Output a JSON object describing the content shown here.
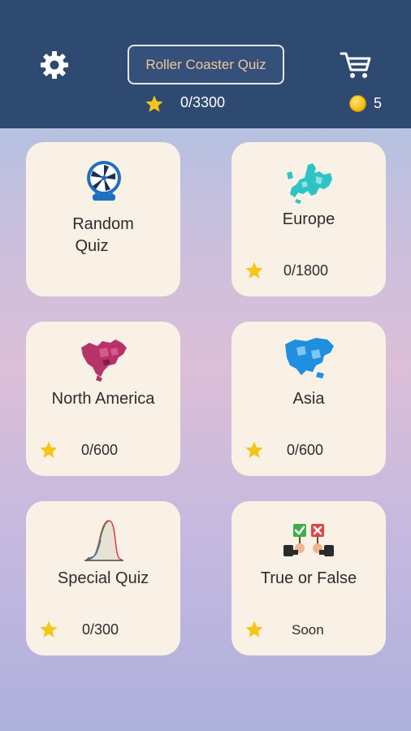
{
  "header": {
    "title": "Roller Coaster Quiz",
    "total_score": "0/3300",
    "coins": "5"
  },
  "colors": {
    "header_bg": "#2f4a70",
    "title_text": "#f2c79b",
    "card_bg": "#f9f1e6",
    "star": "#f5c518"
  },
  "cards": [
    {
      "label_line1": "Random",
      "label_line2": "Quiz",
      "icon": "ferris-wheel-icon"
    },
    {
      "label": "Europe",
      "score": "0/1800",
      "icon": "europe-map-icon"
    },
    {
      "label": "North America",
      "score": "0/600",
      "icon": "north-america-map-icon"
    },
    {
      "label": "Asia",
      "score": "0/600",
      "icon": "asia-map-icon"
    },
    {
      "label": "Special Quiz",
      "score": "0/300",
      "icon": "curve-chart-icon"
    },
    {
      "label": "True or False",
      "score": "Soon",
      "icon": "true-false-icon"
    }
  ]
}
